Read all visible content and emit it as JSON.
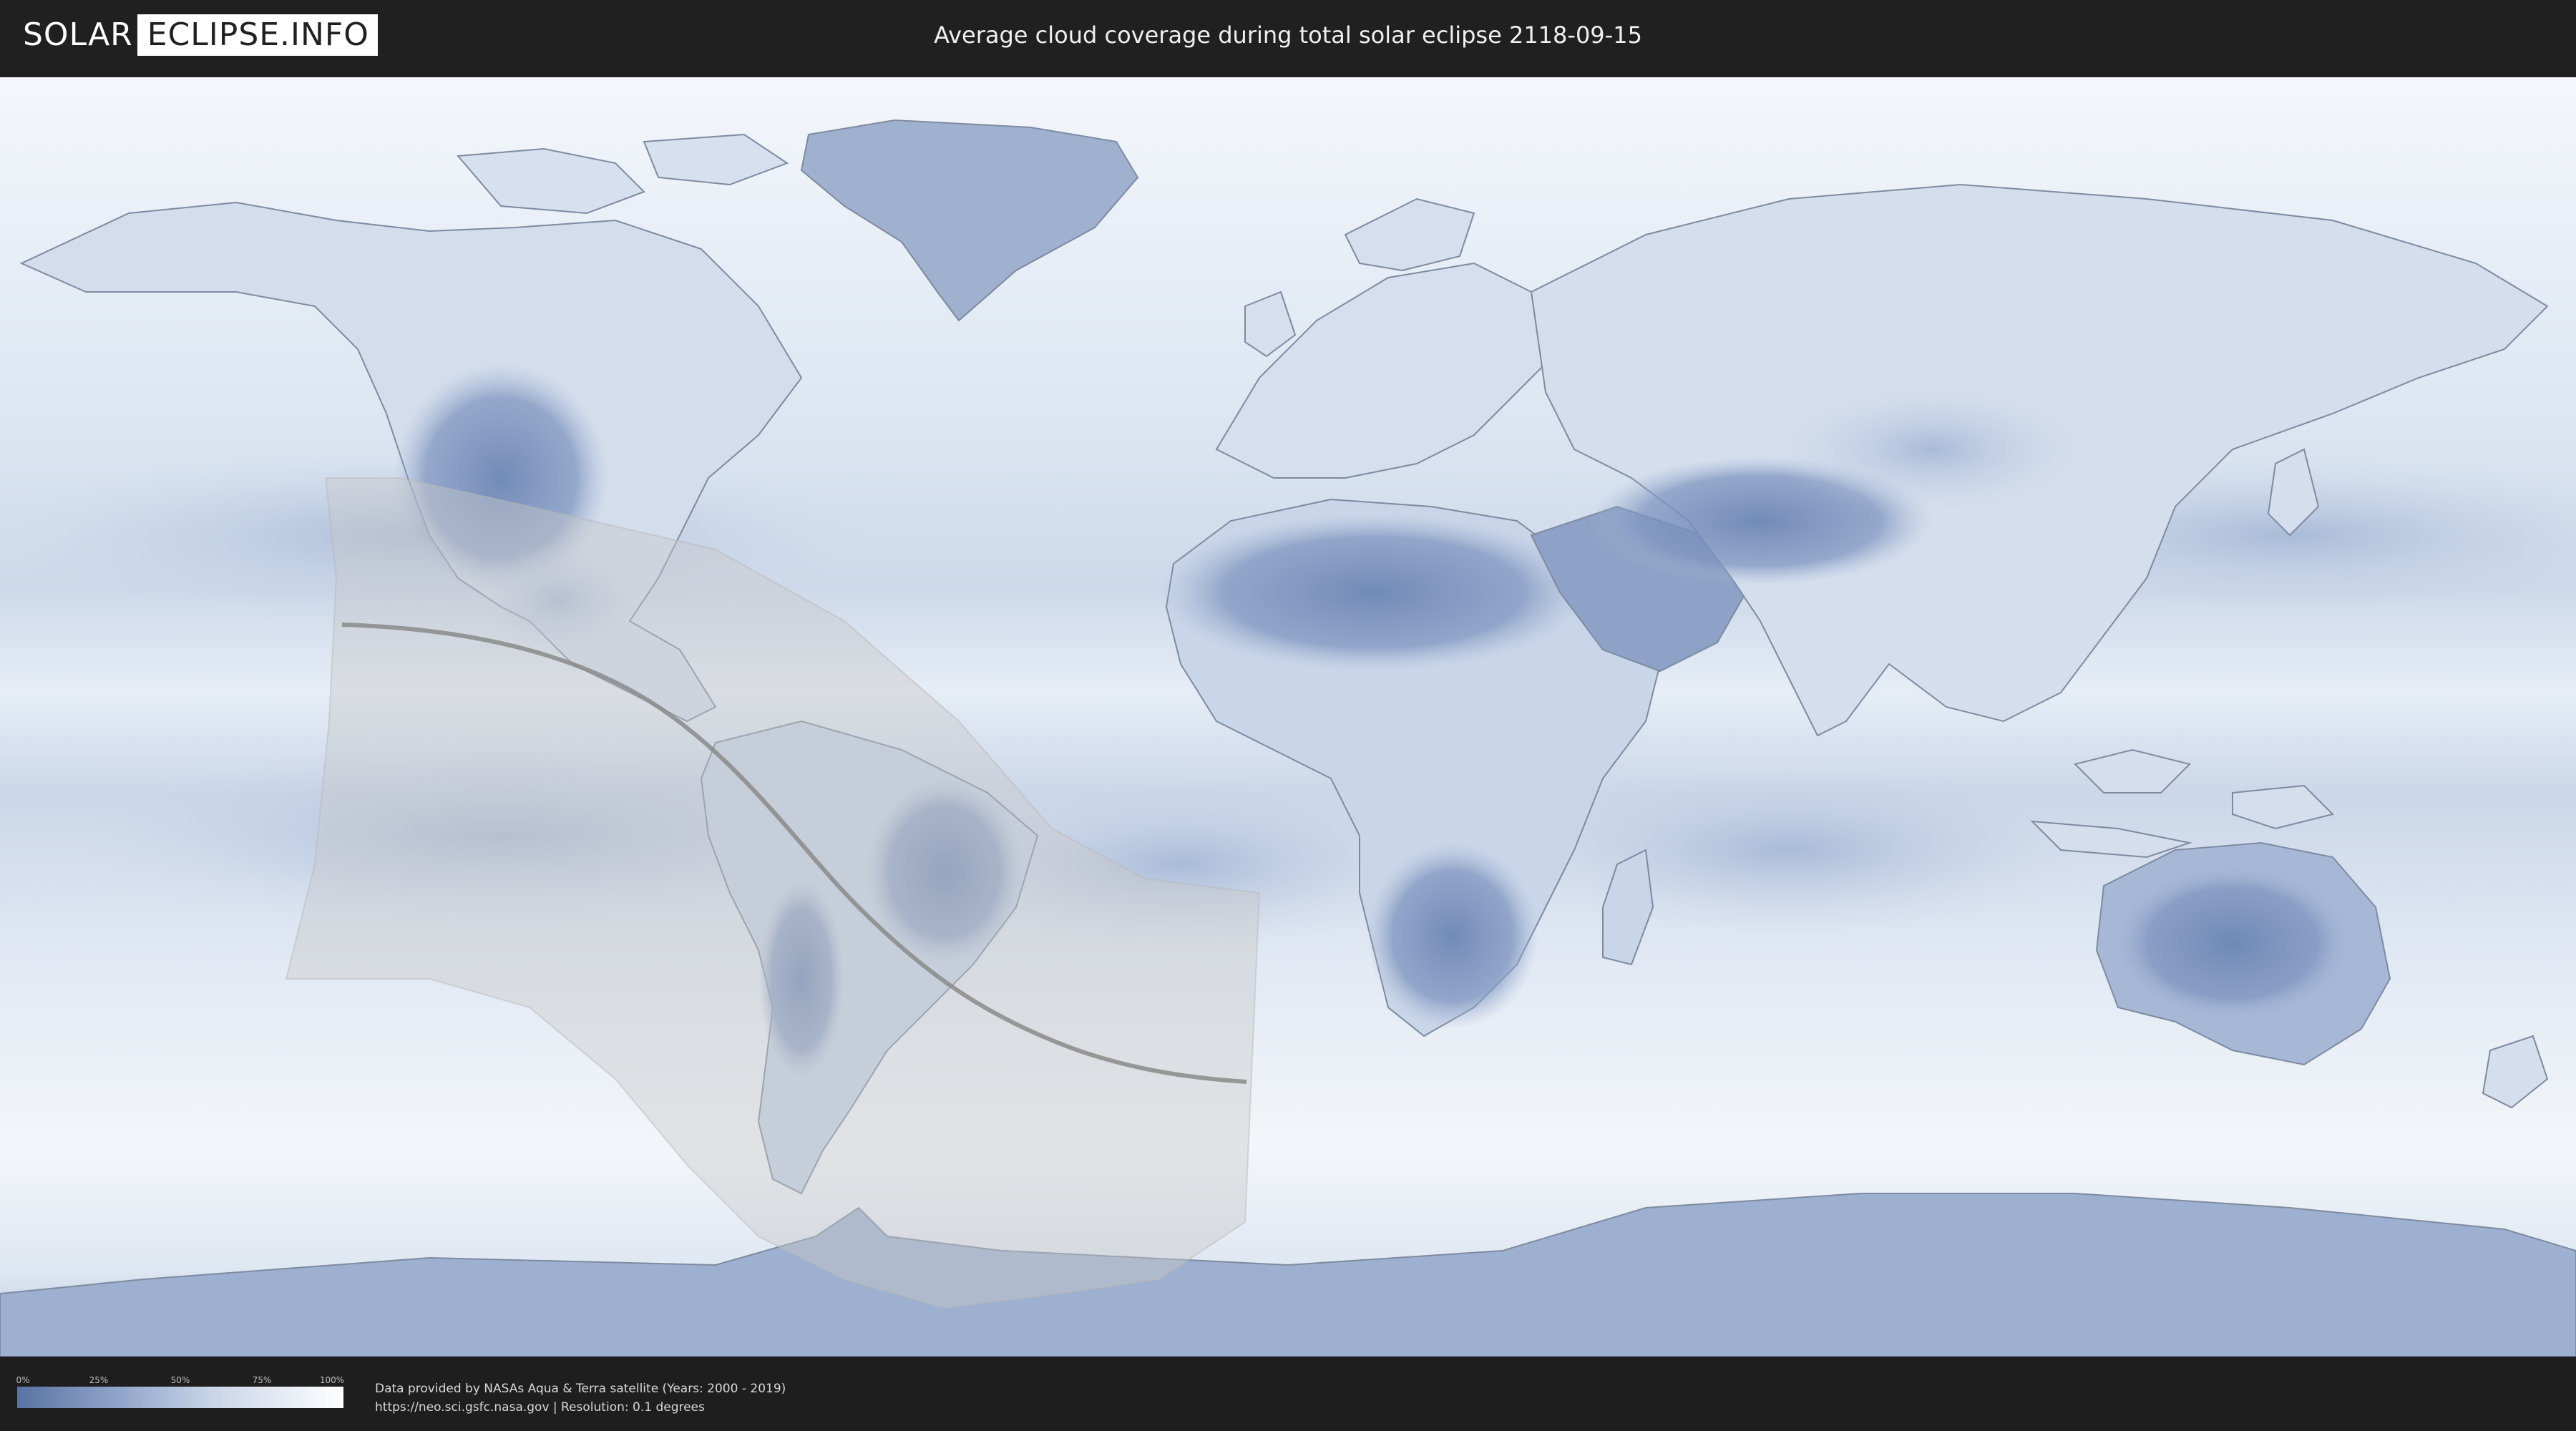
{
  "header": {
    "logo_part1": "SOLAR",
    "logo_part2": "ECLIPSE.INFO",
    "title": "Average cloud coverage during total solar eclipse 2118-09-15"
  },
  "legend": {
    "ticks": [
      "0%",
      "25%",
      "50%",
      "75%",
      "100%"
    ],
    "color_low": "#5a73a3",
    "color_high": "#ffffff"
  },
  "footer": {
    "credit_line1": "Data provided by NASAs Aqua & Terra satellite (Years: 2000 - 2019)",
    "credit_line2": "https://neo.sci.gsfc.nasa.gov | Resolution: 0.1 degrees"
  },
  "map": {
    "projection": "equirectangular",
    "colors": {
      "ocean_cloud": "#eef3f9",
      "clear_sky": "#6a83b3",
      "land_outline": "#7e8aa0",
      "penumbra": "#c8c8c8",
      "central_line": "#8a8a8a"
    }
  }
}
